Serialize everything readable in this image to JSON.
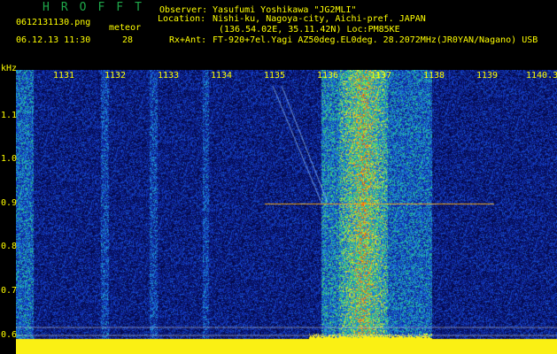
{
  "header": {
    "brand": "HROFFT",
    "filename": "0612131130.png",
    "datetime": "06.12.13 11:30",
    "meteor_label": "meteor",
    "meteor_count": "28",
    "observer_label": "Observer:",
    "observer_value": "Yasufumi Yoshikawa \"JG2MLI\"",
    "location_label": "Location:",
    "location_value": "Nishi-ku, Nagoya-city, Aichi-pref. JAPAN",
    "location_coords": "(136.54.02E, 35.11.42N) Loc:PM85KE",
    "rx_label": "Rx+Ant:",
    "rx_value": "FT-920+7el.Yagi AZ50deg.EL0deg. 28.2072MHz(JR0YAN/Nagano) USB"
  },
  "axis": {
    "unit": "kHz",
    "y_ticks": [
      "1.1",
      "1.0",
      "0.9",
      "0.8",
      "0.7",
      "0.6"
    ],
    "x_ticks": [
      "1131",
      "1132",
      "1133",
      "1134",
      "1135",
      "1136",
      "1137",
      "1138",
      "1139",
      "1140.3"
    ]
  },
  "colors": {
    "background": "#000000",
    "label": "#ffff00",
    "brand": "#1fa84a",
    "waterfall_low": "#0a1a6e",
    "waterfall_high": "#ff2a00"
  }
}
